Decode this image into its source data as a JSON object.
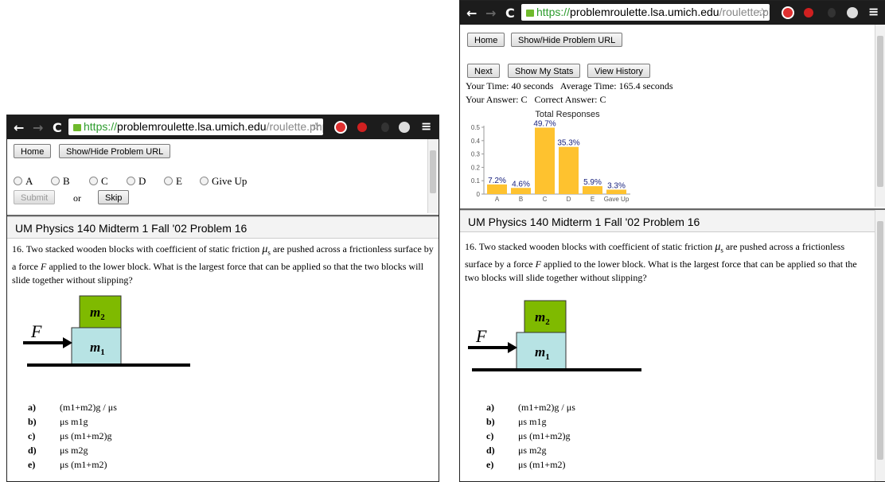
{
  "browser": {
    "url_scheme": "https://",
    "url_host": "problemroulette.lsa.umich.edu",
    "url_path": "/roulette.php"
  },
  "toolbar": {
    "home_label": "Home",
    "show_hide_label": "Show/Hide Problem URL"
  },
  "choices": [
    "A",
    "B",
    "C",
    "D",
    "E",
    "Give Up"
  ],
  "actions": {
    "submit_label": "Submit",
    "or_text": "or",
    "skip_label": "Skip"
  },
  "results": {
    "next_label": "Next",
    "stats_label": "Show My Stats",
    "history_label": "View History",
    "time_line": "Your Time: 40 seconds   Average Time: 165.4 seconds",
    "answer_line": "Your Answer: C   Correct Answer: C"
  },
  "chart_data": {
    "type": "bar",
    "title": "Total Responses",
    "categories": [
      "A",
      "B",
      "C",
      "D",
      "E",
      "Gave Up"
    ],
    "values": [
      0.072,
      0.046,
      0.497,
      0.353,
      0.059,
      0.033
    ],
    "data_labels": [
      "7.2%",
      "4.6%",
      "49.7%",
      "35.3%",
      "5.9%",
      "3.3%"
    ],
    "yticks": [
      "0",
      "0.1",
      "0.2",
      "0.3",
      "0.4",
      "0.5"
    ],
    "ylim": [
      0,
      0.5
    ],
    "bar_color": "#fec22f",
    "label_color": "#1a237e"
  },
  "problem": {
    "title": "UM Physics 140 Midterm 1 Fall '02 Problem 16",
    "text_before_mu": "16.  Two stacked wooden blocks with coefficient of static friction ",
    "mu": "μ",
    "mu_sub": "s",
    "text_mid": " are pushed across a frictionless surface by a force ",
    "F": "F",
    "text_after": " applied to the lower block.  What is the largest force that can be applied so that the two blocks will slide together without slipping?",
    "figure": {
      "F_label": "F",
      "m2_label": "m",
      "m2_sub": "2",
      "m1_label": "m",
      "m1_sub": "1"
    },
    "answers": [
      {
        "letter": "a)",
        "expr": "(m1+m2)g / μs"
      },
      {
        "letter": "b)",
        "expr": "μs m1g"
      },
      {
        "letter": "c)",
        "expr": "μs (m1+m2)g"
      },
      {
        "letter": "d)",
        "expr": "μs m2g"
      },
      {
        "letter": "e)",
        "expr": "μs (m1+m2)"
      }
    ]
  },
  "colors": {
    "chrome_dark": "#1c1c1c",
    "block_top": "#7fba00",
    "block_bottom": "#b7e3e4",
    "lock_green": "#6fba2c"
  }
}
